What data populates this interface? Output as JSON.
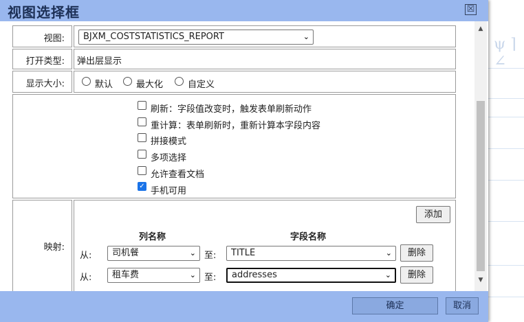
{
  "dialog": {
    "title": "视图选择框",
    "close_symbol": "☒"
  },
  "form": {
    "view": {
      "label": "视图:",
      "selected": "BJXM_COSTSTATISTICS_REPORT"
    },
    "open_type": {
      "label": "打开类型:",
      "value": "弹出层显示"
    },
    "display_size": {
      "label": "显示大小:",
      "options": [
        "默认",
        "最大化",
        "自定义"
      ]
    },
    "options": [
      {
        "label": "刷新：字段值改变时，触发表单刷新动作",
        "checked": false
      },
      {
        "label": "重计算：表单刷新时，重新计算本字段内容",
        "checked": false
      },
      {
        "label": "拼接模式",
        "checked": false
      },
      {
        "label": "多项选择",
        "checked": false
      },
      {
        "label": "允许查看文档",
        "checked": false
      },
      {
        "label": "手机可用",
        "checked": true
      }
    ],
    "mapping": {
      "label": "映射:",
      "add_label": "添加",
      "column_header": "列名称",
      "field_header": "字段名称",
      "from_label": "从:",
      "to_label": "至:",
      "delete_label": "删除",
      "rows": [
        {
          "column": "司机餐",
          "field": "TITLE"
        },
        {
          "column": "租车费",
          "field": "addresses"
        }
      ]
    }
  },
  "footer": {
    "ok_label": "确定",
    "cancel_label": "取消"
  },
  "icons": {
    "select_arrow": "⌄",
    "checkmark": "✓",
    "scroll_up": "▲",
    "scroll_down": "▼"
  },
  "background": {
    "glyph": "ψ ⌉ ∠"
  }
}
